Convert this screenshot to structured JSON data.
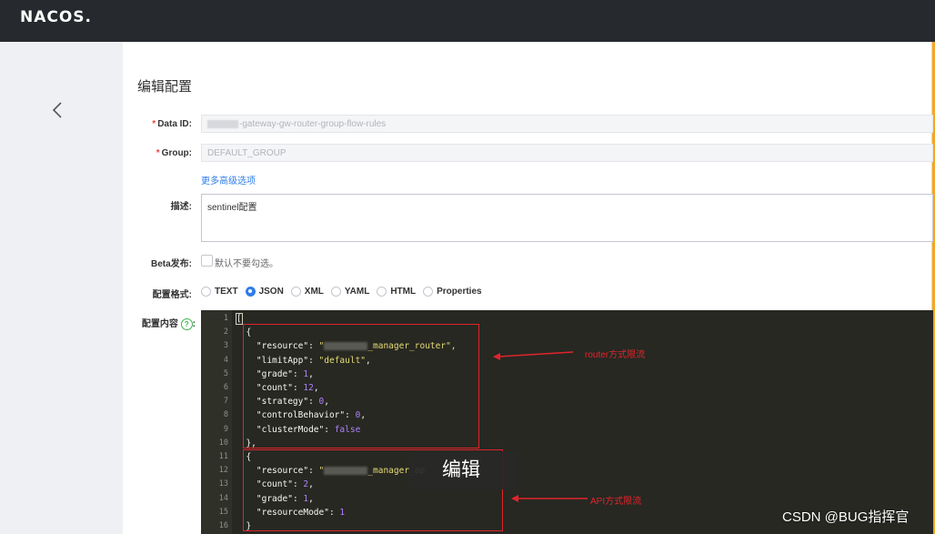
{
  "header": {
    "logo": "NACOS."
  },
  "page": {
    "title": "编辑配置"
  },
  "form": {
    "data_id": {
      "label": "Data ID:",
      "value": "-gateway-gw-router-group-flow-rules"
    },
    "group": {
      "label": "Group:",
      "value": "DEFAULT_GROUP"
    },
    "advanced_link": "更多高级选项",
    "description": {
      "label": "描述:",
      "value": "sentinel配置"
    },
    "beta": {
      "label": "Beta发布:",
      "checkbox_text": "默认不要勾选。"
    },
    "format": {
      "label": "配置格式:",
      "options": [
        "TEXT",
        "JSON",
        "XML",
        "YAML",
        "HTML",
        "Properties"
      ],
      "selected": "JSON"
    },
    "content": {
      "label": "配置内容"
    }
  },
  "editor": {
    "line_numbers": [
      "1",
      "2",
      "3",
      "4",
      "5",
      "6",
      "7",
      "8",
      "9",
      "10",
      "11",
      "12",
      "13",
      "14",
      "15",
      "16"
    ],
    "lines": [
      "[",
      "  {",
      "    \"resource\": \"",
      "    \"limitApp\": \"default\",",
      "    \"grade\": 1,",
      "    \"count\":12,",
      "    \"strategy\": 0,",
      "    \"controlBehavior\": 0,",
      "    \"clusterMode\": false",
      "  },",
      "  {",
      "    \"resource\": \"",
      "    \"count\": 2,",
      "    \"grade\": 1,",
      "    \"resourceMode\": 1",
      "  }"
    ],
    "resource1_suffix": "_manager_router\",",
    "resource2_suffix": "_manager_ap"
  },
  "annotations": {
    "router": "router方式限流",
    "api": "API方式限流"
  },
  "tooltip": "编辑",
  "watermark": "CSDN @BUG指挥官",
  "colors": {
    "topbar": "#262a2f",
    "accent": "#2f7ee6",
    "annotation_red": "#e0242b",
    "editor_bg": "#272822"
  }
}
